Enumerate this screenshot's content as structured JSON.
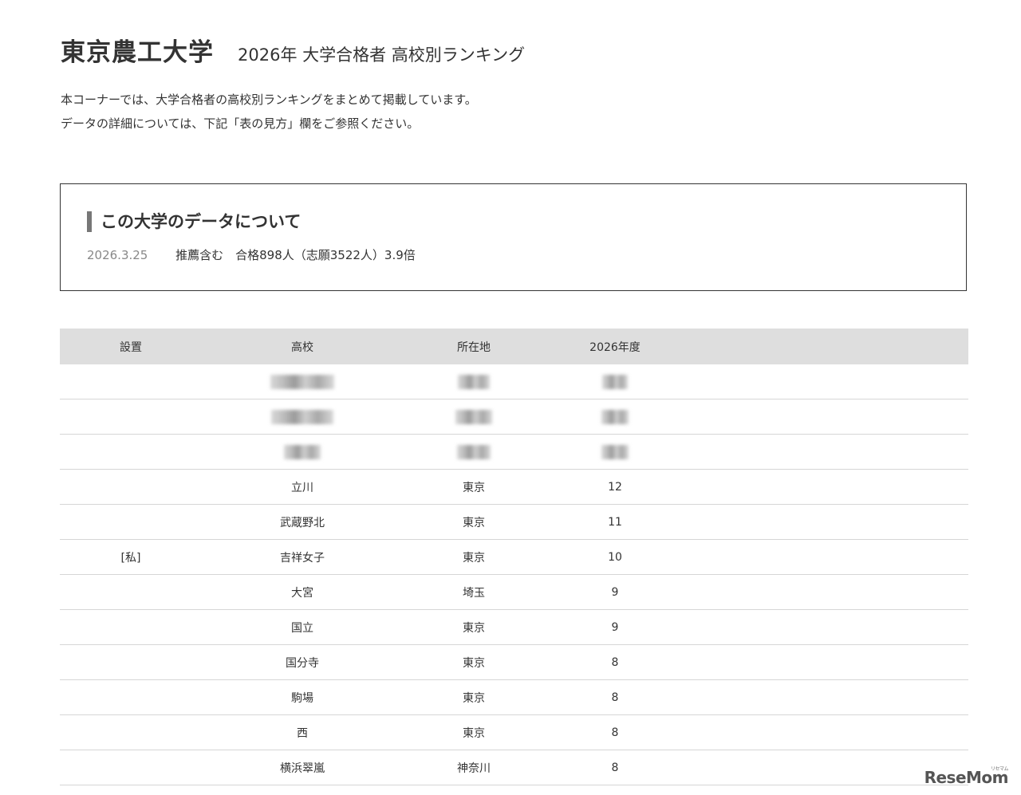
{
  "header": {
    "university": "東京農工大学",
    "subtitle": "2026年 大学合格者 高校別ランキング"
  },
  "intro": {
    "line1": "本コーナーでは、大学合格者の高校別ランキングをまとめて掲載しています。",
    "line2": "データの詳細については、下記「表の見方」欄をご参照ください。"
  },
  "info": {
    "heading": "この大学のデータについて",
    "date": "2026.3.25",
    "detail": "推薦含む　合格898人（志願3522人）3.9倍"
  },
  "table": {
    "headers": [
      "設置",
      "高校",
      "所在地",
      "2026年度"
    ],
    "rows": [
      {
        "type": "",
        "school": "",
        "location": "",
        "count": "",
        "blurred": true
      },
      {
        "type": "",
        "school": "",
        "location": "",
        "count": "",
        "blurred": true
      },
      {
        "type": "",
        "school": "",
        "location": "",
        "count": "",
        "blurred": true
      },
      {
        "type": "",
        "school": "立川",
        "location": "東京",
        "count": "12"
      },
      {
        "type": "",
        "school": "武蔵野北",
        "location": "東京",
        "count": "11"
      },
      {
        "type": "[私]",
        "school": "吉祥女子",
        "location": "東京",
        "count": "10"
      },
      {
        "type": "",
        "school": "大宮",
        "location": "埼玉",
        "count": "9"
      },
      {
        "type": "",
        "school": "国立",
        "location": "東京",
        "count": "9"
      },
      {
        "type": "",
        "school": "国分寺",
        "location": "東京",
        "count": "8"
      },
      {
        "type": "",
        "school": "駒場",
        "location": "東京",
        "count": "8"
      },
      {
        "type": "",
        "school": "西",
        "location": "東京",
        "count": "8"
      },
      {
        "type": "",
        "school": "横浜翠嵐",
        "location": "神奈川",
        "count": "8"
      }
    ]
  },
  "watermark": {
    "text": "ReseMom",
    "small": "リセマム"
  }
}
